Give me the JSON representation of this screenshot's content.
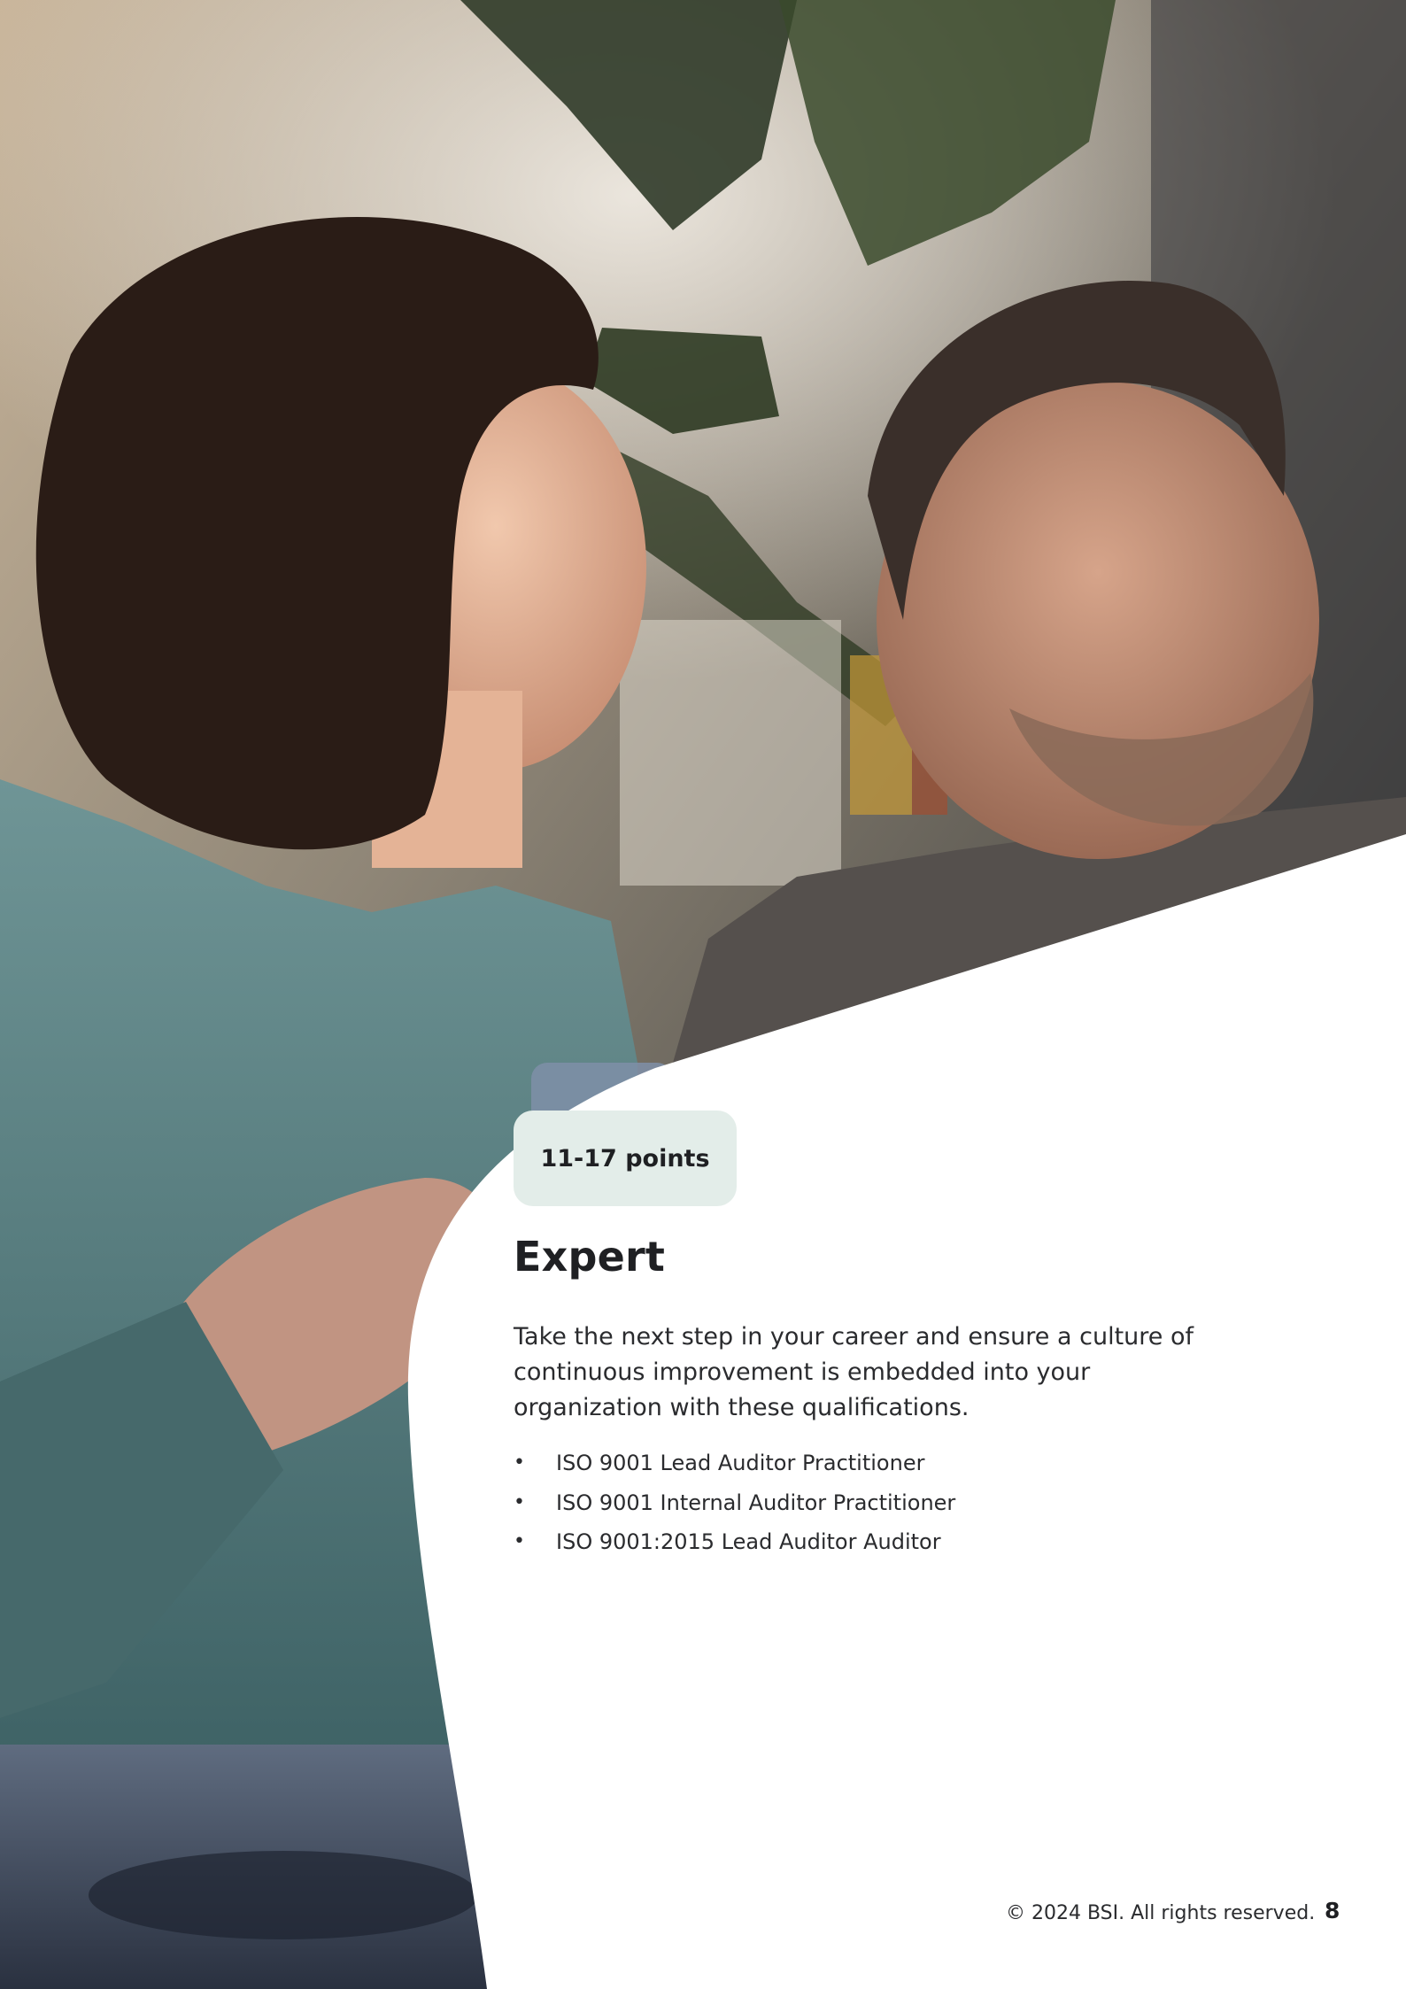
{
  "level": {
    "points_label": "11-17 points",
    "title": "Expert",
    "description": "Take the next step in your career and ensure a culture of continuous improvement is embedded into your organization with these qualifications.",
    "qualifications": [
      "ISO 9001 Lead Auditor Practitioner",
      "ISO 9001 Internal Auditor Practitioner",
      "ISO 9001:2015 Lead Auditor Auditor"
    ]
  },
  "bullet_glyph": "•",
  "footer": {
    "copyright": "© 2024 BSI. All rights reserved.",
    "page_number": "8"
  },
  "colors": {
    "badge_background": "#e3ede9",
    "panel_background": "#ffffff",
    "text_primary": "#1f2023"
  }
}
